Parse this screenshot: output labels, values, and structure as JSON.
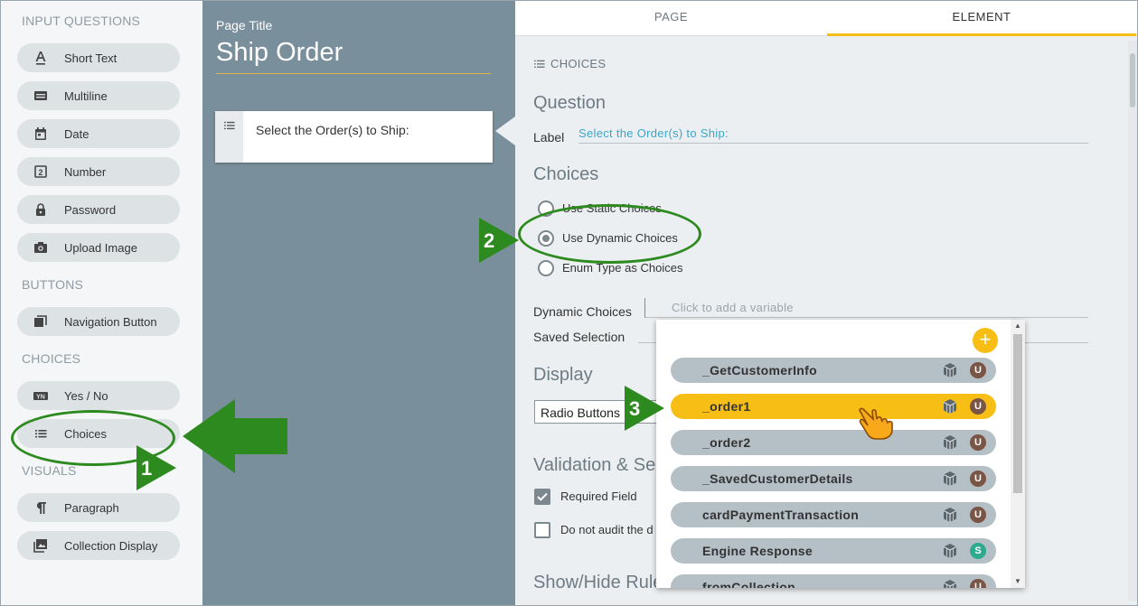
{
  "palette": {
    "sections": {
      "input_questions": "INPUT QUESTIONS",
      "buttons": "BUTTONS",
      "choices": "CHOICES",
      "visuals": "VISUALS"
    },
    "items": {
      "short_text": "Short Text",
      "multiline": "Multiline",
      "date": "Date",
      "number": "Number",
      "password": "Password",
      "upload_image": "Upload Image",
      "navigation_button": "Navigation Button",
      "yes_no": "Yes / No",
      "choices": "Choices",
      "paragraph": "Paragraph",
      "collection_display": "Collection Display"
    }
  },
  "canvas": {
    "page_title_label": "Page Title",
    "page_title": "Ship Order",
    "question_text": "Select the Order(s) to Ship:"
  },
  "props": {
    "tabs": {
      "page": "PAGE",
      "element": "ELEMENT"
    },
    "crumb": "CHOICES",
    "question_heading": "Question",
    "label_caption": "Label",
    "label_value": "Select the Order(s) to Ship:",
    "choices_heading": "Choices",
    "radios": {
      "static": "Use Static Choices",
      "dynamic": "Use Dynamic Choices",
      "enum": "Enum Type as Choices"
    },
    "dynamic_choices_label": "Dynamic Choices",
    "dynamic_choices_placeholder": "Click to add a variable",
    "saved_selection_label": "Saved Selection",
    "display_heading": "Display",
    "display_select_value": "Radio Buttons",
    "validation_heading": "Validation & Sec",
    "required_field": "Required Field",
    "do_not_audit": "Do not audit the d",
    "show_hide_heading": "Show/Hide Rule"
  },
  "dropdown": {
    "add_symbol": "+",
    "variables": [
      {
        "name": "_GetCustomerInfo",
        "badge": "U"
      },
      {
        "name": "_order1",
        "badge": "U",
        "selected": true
      },
      {
        "name": "_order2",
        "badge": "U"
      },
      {
        "name": "_SavedCustomerDetails",
        "badge": "U"
      },
      {
        "name": "cardPaymentTransaction",
        "badge": "U"
      },
      {
        "name": "Engine Response",
        "badge": "S"
      },
      {
        "name": "fromCollection",
        "badge": "U"
      }
    ]
  },
  "annotations": {
    "step1": "1",
    "step2": "2",
    "step3": "3"
  },
  "colors": {
    "accent": "#f7be16",
    "annotation_green": "#2d8a1f",
    "canvas": "#7a8f9c",
    "link": "#3aa7c9"
  }
}
